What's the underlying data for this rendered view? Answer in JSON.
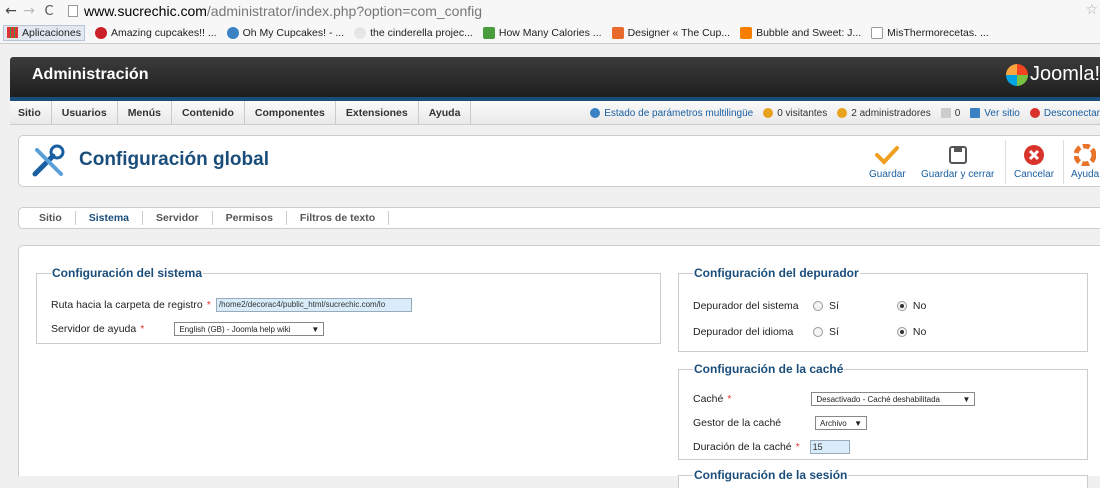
{
  "browser": {
    "url_host": "www.sucrechic.com",
    "url_path": "/administrator/index.php?option=com_config",
    "bookmarks": [
      {
        "label": "Aplicaciones",
        "icon": "apps-icon"
      },
      {
        "label": "Amazing cupcakes!! ...",
        "icon": "pinterest-icon",
        "color": "#cb2027"
      },
      {
        "label": "Oh My Cupcakes! - ...",
        "icon": "globe-icon",
        "color": "#3b82c4"
      },
      {
        "label": "the cinderella projec...",
        "icon": "heart-icon",
        "color": "#e6e6e6"
      },
      {
        "label": "How Many Calories ...",
        "icon": "leaf-icon",
        "color": "#4a9d3c"
      },
      {
        "label": "Designer « The Cup...",
        "icon": "cupcake-icon",
        "color": "#e86a2c"
      },
      {
        "label": "Bubble and Sweet: J...",
        "icon": "blogger-icon",
        "color": "#f57d00"
      },
      {
        "label": "MisThermorecetas. ...",
        "icon": "page-icon",
        "color": "#ffffff"
      }
    ]
  },
  "header": {
    "title": "Administración",
    "logo_text": "Joomla!"
  },
  "menu": {
    "items": [
      "Sitio",
      "Usuarios",
      "Menús",
      "Contenido",
      "Componentes",
      "Extensiones",
      "Ayuda"
    ],
    "status": {
      "multilang": "Estado de parámetros multilingüe",
      "visitors": "0 visitantes",
      "admins": "2 administradores",
      "messages": "0",
      "view_site": "Ver sitio",
      "logout": "Desconectar"
    }
  },
  "toolbar": {
    "title": "Configuración global",
    "save": "Guardar",
    "save_close": "Guardar y cerrar",
    "cancel": "Cancelar",
    "help": "Ayuda"
  },
  "tabs": [
    "Sitio",
    "Sistema",
    "Servidor",
    "Permisos",
    "Filtros de texto"
  ],
  "active_tab": "Sistema",
  "system_config": {
    "legend": "Configuración del sistema",
    "log_path_label": "Ruta hacia la carpeta de registro",
    "log_path_value": "/home2/decorac4/public_html/sucrechic.com/lo",
    "help_server_label": "Servidor de ayuda",
    "help_server_value": "English (GB) - Joomla help wiki"
  },
  "debug_config": {
    "legend": "Configuración del depurador",
    "debug_system_label": "Depurador del sistema",
    "debug_lang_label": "Depurador del idioma",
    "yes": "Sí",
    "no": "No",
    "debug_system_value": "No",
    "debug_lang_value": "No"
  },
  "cache_config": {
    "legend": "Configuración de la caché",
    "cache_label": "Caché",
    "cache_value": "Desactivado - Caché deshabilitada",
    "handler_label": "Gestor de la caché",
    "handler_value": "Archivo",
    "duration_label": "Duración de la caché",
    "duration_value": "15"
  },
  "next_legend": "Configuración de la sesión",
  "colors": {
    "accent": "#1a4d7a",
    "link": "#1a5fa0",
    "required": "#ee3333",
    "save_icon": "#f0a020",
    "cancel_icon": "#d9342b",
    "help_icon": "#e8742c"
  }
}
